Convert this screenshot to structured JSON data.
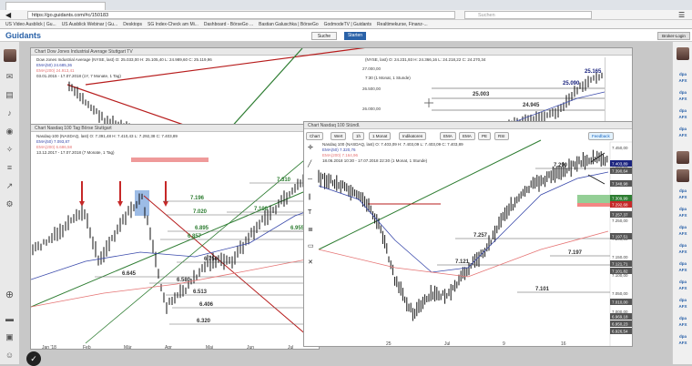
{
  "browser": {
    "url": "https://go.guidants.com/#c/150183",
    "search_placeholder": "Suchen"
  },
  "bookmarks": [
    "US Video Ausblick | Gu...",
    "US Ausblick Webinar | Gu...",
    "Desktops",
    "SG Index-Check am Mi...",
    "Dashboard - BörseGo ...",
    "Bastian Galuschka | BörseGo",
    "GodmodeTV | Guidants",
    "Realtimekurse, Finanz-..."
  ],
  "app": {
    "logo": "Guidants",
    "search_label": "Suche",
    "new_label": "Neu",
    "publish_label": "Starten",
    "broker_label": "Broker-Login"
  },
  "dow": {
    "title": "Chart Dow Jones Industrial Average Stuttgart TV",
    "legend": [
      "Dow Jones Industrial Average (NYSE, last) O: 25.033,00 H: 25.105,40 L: 24.989,60 C: 25.119,96",
      "EMA(50) 24.685,36",
      "EMA(200) 24.913,41",
      "03.01.2015 - 17.07.2018 (1Y, 7 Monate, 1 Tag)"
    ],
    "right_legend": "(NYSE, last) O: 24.231,93 H: 24.366,16 L: 24.218,22 C: 24.270,34",
    "right_sub": "7:30 (1 Monat, 1 Stunde)",
    "price_ticks": [
      "27.000,00",
      "26.500,00",
      "26.000,00",
      "25.500,00"
    ],
    "labels": [
      "25.003",
      "24.945",
      "25.090",
      "25.165"
    ],
    "price_tags": [
      "25.175,31",
      "25.119,83",
      "25.090,40",
      "24.934,72"
    ]
  },
  "nasdaq_daily": {
    "title": "Chart Nasdaq 100 Tag Börse Stuttgart",
    "legend": [
      "Nasdaq-100 (NASDAQ, last) O: 7.391,48 H: 7.410,43 L: 7.292,38 C: 7.403,89",
      "EMA(50) 7.093,87",
      "EMA(200) 6.686,58",
      "13.12.2017 - 17.07.2018 (7 Monate, 1 Tag)"
    ],
    "levels": [
      "7.196",
      "7.020",
      "6.895",
      "6.857",
      "6.750",
      "6.645",
      "6.580",
      "6.513",
      "6.406",
      "6.320",
      "7.100",
      "7.310",
      "6.955"
    ],
    "x_labels": [
      "Jan '18",
      "Feb",
      "Mär",
      "Apr",
      "Mai",
      "Jun",
      "Jul"
    ]
  },
  "nasdaq_hourly": {
    "title": "Chart Nasdaq 100 Stündl.",
    "toolbar": [
      "Chart",
      "Wert",
      "1h",
      "1 Monat",
      "Indikatoren",
      "EMA",
      "EMA",
      "PE",
      "RSI",
      "Feedback"
    ],
    "legend": [
      "Nasdaq 100 (NASDAQ, last) O: 7.403,09 H: 7.403,09 L: 7.403,09 C: 7.403,89",
      "EMA(50) 7.320,76",
      "EMA(200) 7.164,96",
      "18.06.2018 10:30 - 17.07.2018 22:30 (1 Monat, 1 Stunde)"
    ],
    "levels": [
      "7.290",
      "7.257",
      "7.197",
      "7.121",
      "7.101"
    ],
    "price_ticks": [
      "7.450,00",
      "7.400,00",
      "7.350,00",
      "7.300,00",
      "7.250,00",
      "7.200,00",
      "7.150,00",
      "7.100,00",
      "7.050,00",
      "7.000,00",
      "6.950,00"
    ],
    "price_tags": [
      "7.403,89",
      "7.390,64",
      "7.348,98",
      "7.309,99",
      "7.292,68",
      "7.257,37",
      "7.197,51",
      "7.121,71",
      "7.101,82",
      "7.010,00",
      "6.969,18",
      "6.950,23",
      "6.926,54"
    ],
    "x_labels": [
      "25",
      "Jul",
      "9",
      "16"
    ]
  },
  "colors": {
    "brand": "#2a62a8",
    "green_line": "#2e7d32",
    "red_line": "#b71c1c",
    "ema50": "#3949ab",
    "ema200": "#e57373",
    "tag_green": "#2e7d32",
    "tag_red": "#c62828",
    "tag_blue": "#1a237e",
    "tag_gray": "#555555"
  }
}
